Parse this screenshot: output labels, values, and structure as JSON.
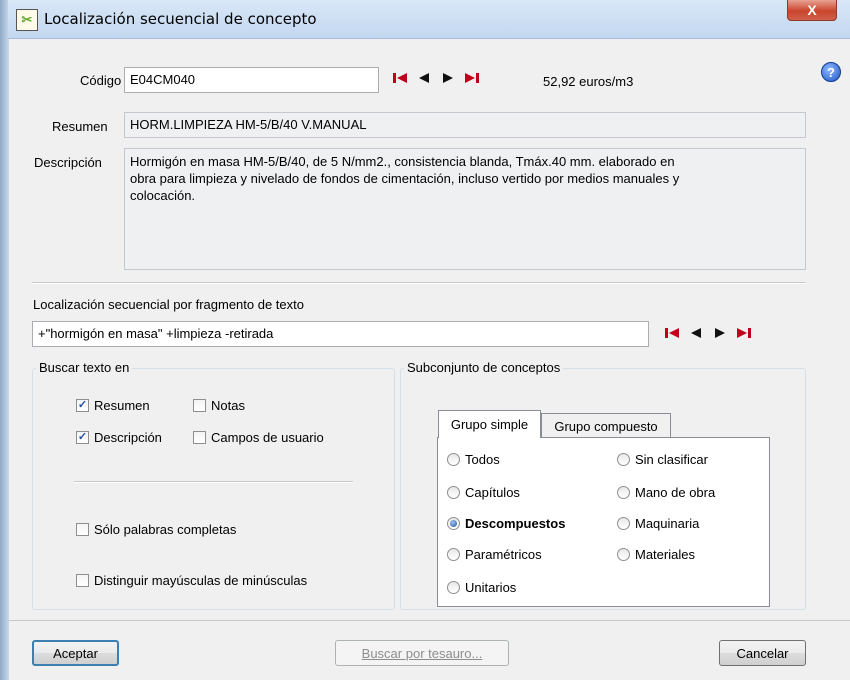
{
  "window": {
    "title": "Localización secuencial de concepto",
    "close_label": "X",
    "help_label": "?"
  },
  "codigo": {
    "label": "Código",
    "value": "E04CM040",
    "price": "52,92 euros/m3"
  },
  "resumen": {
    "label": "Resumen",
    "value": "HORM.LIMPIEZA HM-5/B/40 V.MANUAL"
  },
  "descripcion": {
    "label": "Descripción",
    "lines": [
      "Hormigón en masa HM-5/B/40, de 5 N/mm2., consistencia blanda, Tmáx.40 mm. elaborado en",
      "obra para limpieza y nivelado de fondos de cimentación, incluso vertido por medios manuales y",
      "colocación."
    ]
  },
  "fragmento": {
    "label": "Localización secuencial por fragmento de texto",
    "value": "+\"hormigón en masa\" +limpieza -retirada"
  },
  "nav_icons": [
    "first-icon",
    "prev-icon",
    "next-icon",
    "last-icon"
  ],
  "colors": {
    "nav_red": "#c0001a",
    "nav_black": "#111111"
  },
  "buscar": {
    "legend": "Buscar texto en",
    "resumen": {
      "label": "Resumen",
      "checked": true
    },
    "notas": {
      "label": "Notas",
      "checked": false
    },
    "descripcion": {
      "label": "Descripción",
      "checked": true
    },
    "campos": {
      "label": "Campos de usuario",
      "checked": false
    },
    "palabras": {
      "label": "Sólo palabras completas",
      "checked": false
    },
    "mayusculas": {
      "label": "Distinguir mayúsculas de minúsculas",
      "checked": false
    }
  },
  "subconjunto": {
    "legend": "Subconjunto de conceptos",
    "tabs": [
      "Grupo simple",
      "Grupo compuesto"
    ],
    "active_tab": "Grupo simple",
    "options_left": [
      "Todos",
      "Capítulos",
      "Descompuestos",
      "Paramétricos",
      "Unitarios"
    ],
    "options_right": [
      "Sin clasificar",
      "Mano de obra",
      "Maquinaria",
      "Materiales"
    ],
    "selected": "Descompuestos"
  },
  "buttons": {
    "aceptar": "Aceptar",
    "tesauro": "Buscar por tesauro...",
    "cancelar": "Cancelar"
  }
}
